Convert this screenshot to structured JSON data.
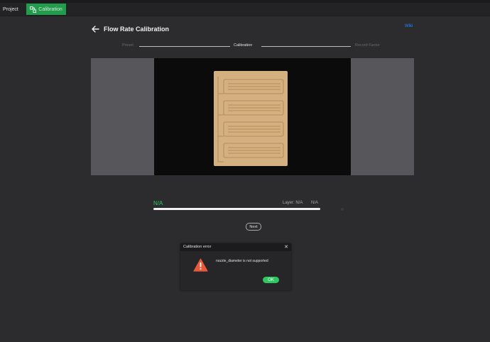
{
  "tabs": {
    "project": "Project",
    "calibration": "Calibration"
  },
  "header": {
    "title": "Flow Rate Calibration",
    "wiki": "Wiki"
  },
  "steps": [
    "Preset",
    "Calibration",
    "Record Factor"
  ],
  "progress": {
    "percent_text": "N/A",
    "layer_text": "Layer: N/A",
    "time_text": "N/A",
    "fill_fraction": 1.0
  },
  "next_label": "Next",
  "dialog": {
    "title": "Calibration error",
    "close": "✕",
    "message": "nozzle_diameter is not supported",
    "ok_label": "OK"
  },
  "colors": {
    "accent": "#2ec760",
    "tab_active": "#1f9d4a",
    "link": "#1e88ff",
    "warning": "#e8583a"
  },
  "icons": {
    "calibration_tab": "calibration-icon",
    "back": "back-arrow-icon",
    "warning": "warning-icon",
    "close": "close-icon"
  }
}
